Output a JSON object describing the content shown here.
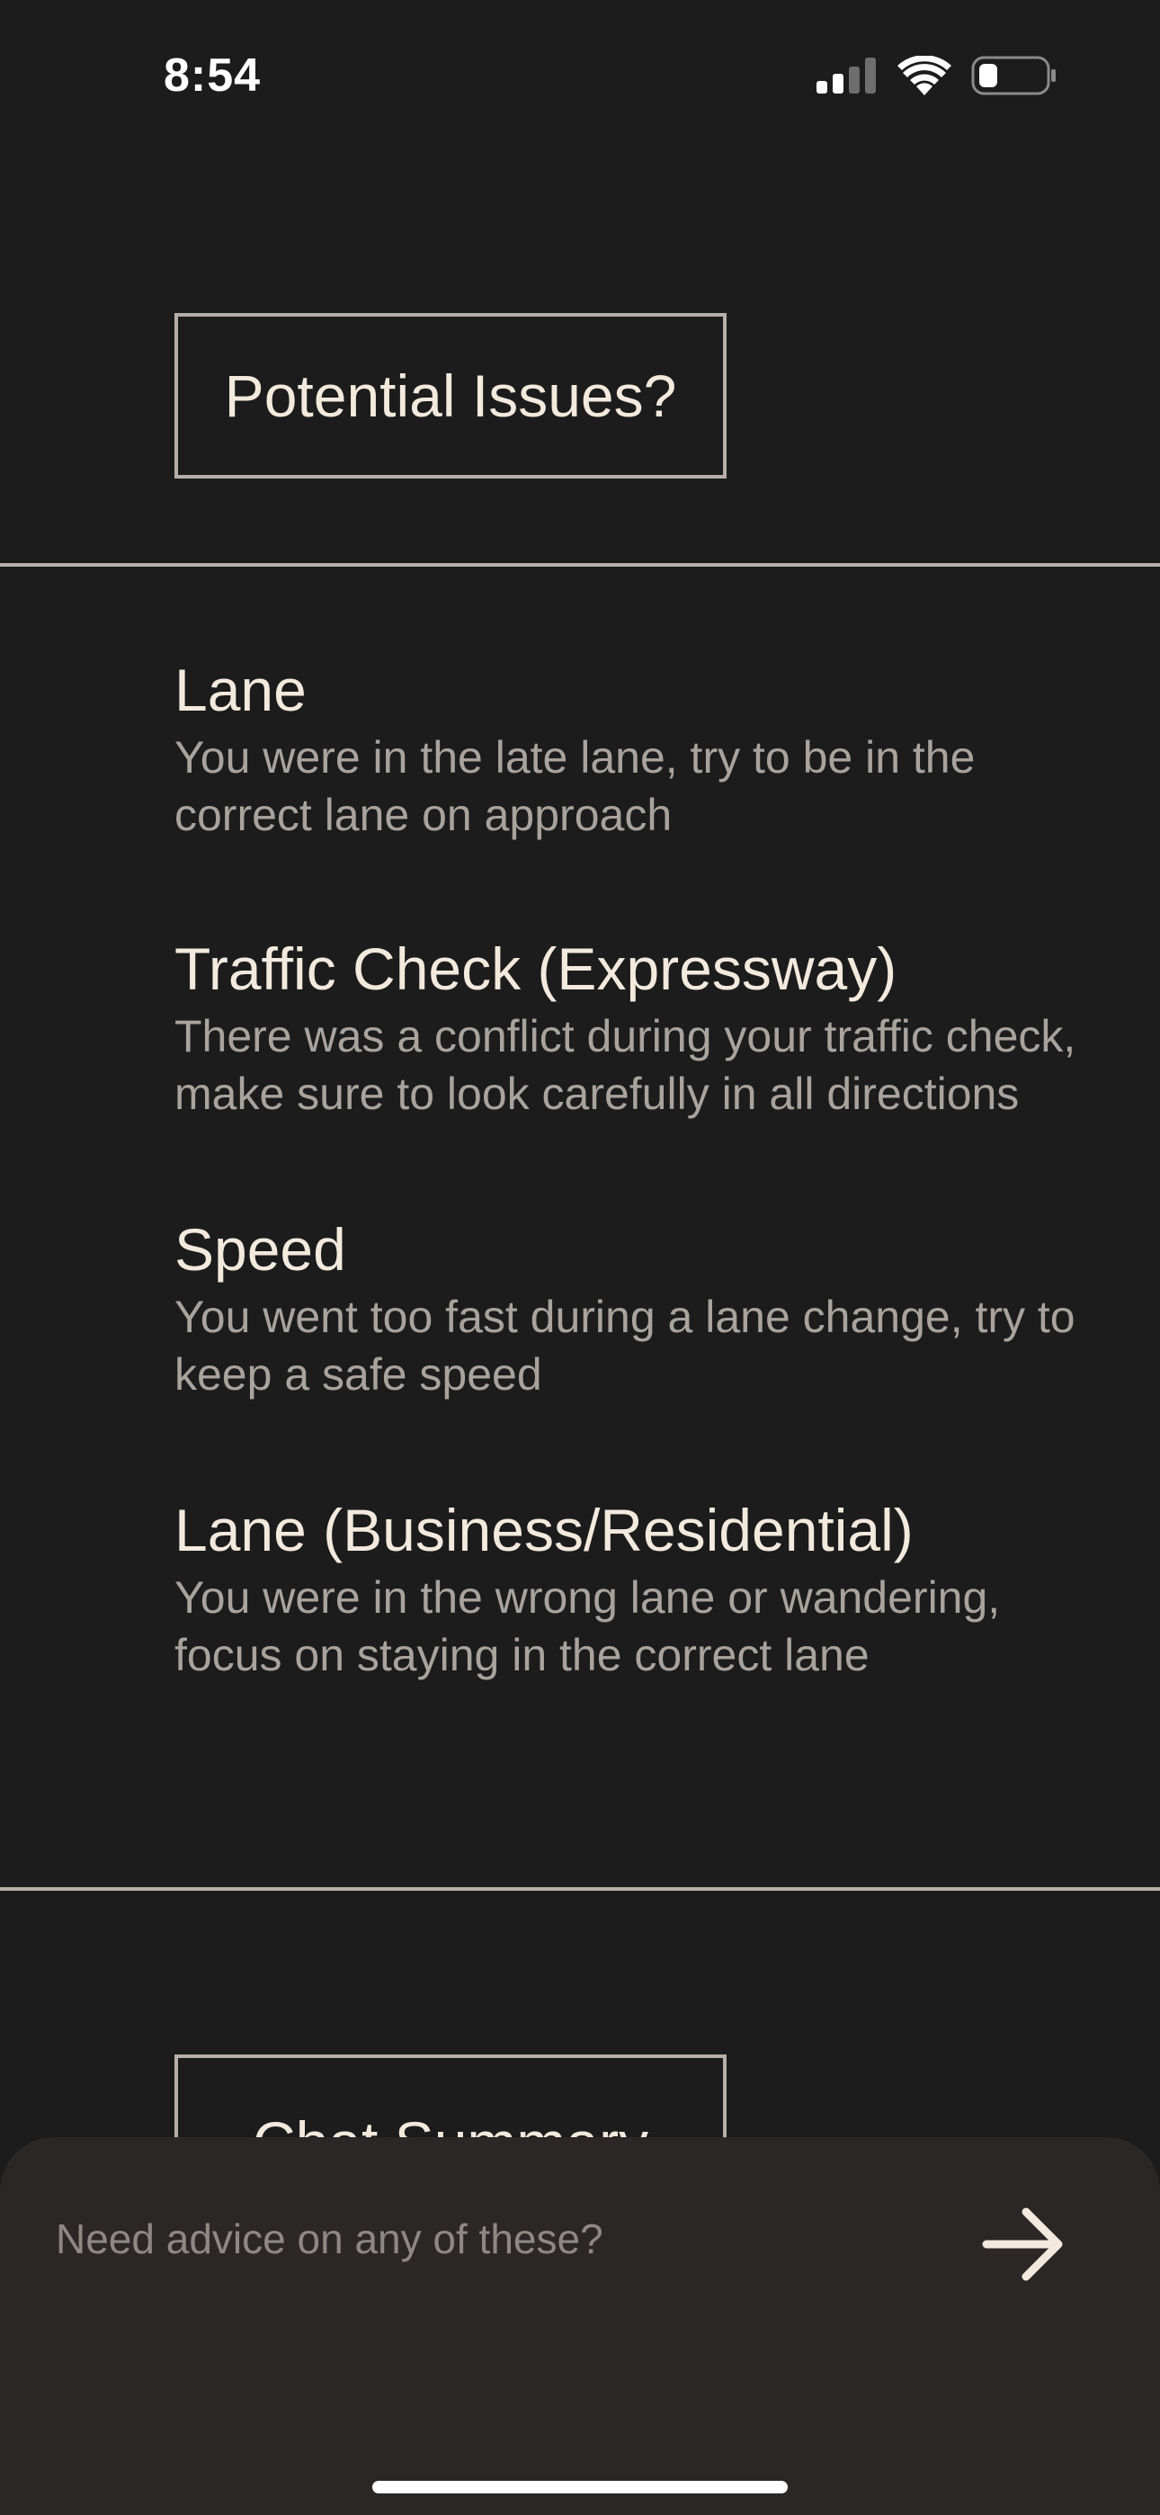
{
  "status_bar": {
    "time": "8:54",
    "icons": [
      "cellular-signal-icon",
      "wifi-icon",
      "battery-icon"
    ]
  },
  "header": {
    "title": "Potential Issues?"
  },
  "issues": [
    {
      "title": "Lane",
      "description": "You were in the late lane, try to be in the correct lane on approach"
    },
    {
      "title": "Traffic Check (Expressway)",
      "description": "There was a conflict during your traffic check, make sure to look carefully in all directions"
    },
    {
      "title": "Speed",
      "description": "You went too fast during a lane change, try to keep a safe speed"
    },
    {
      "title": "Lane (Business/Residential)",
      "description": "You were in the wrong lane or wandering, focus on staying in the correct lane"
    }
  ],
  "chat_summary": {
    "label": "Chat Summary"
  },
  "input": {
    "placeholder": "Need advice on any of these?",
    "send_icon": "arrow-right-icon"
  },
  "colors": {
    "background": "#1c1c1c",
    "sheet": "#2c2727",
    "text_primary": "#f3e9dc",
    "text_secondary": "#a9a39c",
    "border": "#b7b0a8"
  }
}
